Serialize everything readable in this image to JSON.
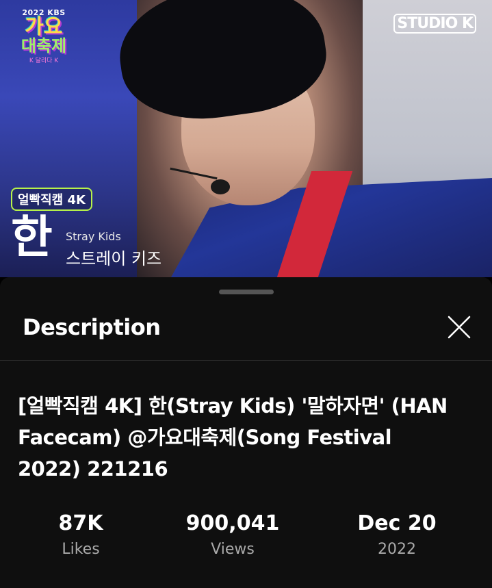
{
  "video": {
    "kbs_year": "2022 KBS",
    "kbs_title_line1": "가요",
    "kbs_title_line2": "대축제",
    "kbs_subtitle": "K 달리다 K",
    "studio_mark": "STUDIO K",
    "cam_tag": "얼빡직캠 4K",
    "member_name": "한",
    "group_en": "Stray Kids",
    "group_ko": "스트레이 키즈"
  },
  "sheet": {
    "title": "Description",
    "close_icon": "close-icon",
    "video_title": "[얼빡직캠 4K] 한(Stray Kids) '말하자면' (HAN Facecam) @가요대축제(Song Festival 2022) 221216"
  },
  "stats": [
    {
      "value": "87K",
      "label": "Likes"
    },
    {
      "value": "900,041",
      "label": "Views"
    },
    {
      "value": "Dec 20",
      "label": "2022"
    }
  ],
  "colors": {
    "sheet_bg": "#0f0f0f",
    "secondary_text": "#aaaaaa",
    "accent_green": "#b7f24a"
  }
}
